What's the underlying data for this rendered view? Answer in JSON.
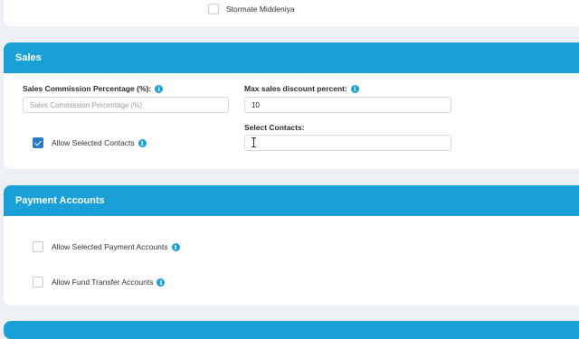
{
  "top_section": {
    "checkbox_label": "Stormate Middeniya",
    "checked": false
  },
  "sales": {
    "title": "Sales",
    "commission_label": "Sales Commission Percentage (%):",
    "commission_placeholder": "Sales Commission Percentage (%)",
    "max_discount_label": "Max sales discount percent:",
    "max_discount_value": "10",
    "allow_contacts_label": "Allow Selected Contacts",
    "allow_contacts_checked": true,
    "select_contacts_label": "Select Contacts:",
    "select_contacts_value": ""
  },
  "payment_accounts": {
    "title": "Payment Accounts",
    "items": [
      {
        "label": "Allow Selected Payment Accounts",
        "checked": false
      },
      {
        "label": "Allow Fund Transfer Accounts",
        "checked": false
      }
    ]
  },
  "colors": {
    "header_bg": "#1aa0d9",
    "checkbox_checked": "#2a79c2",
    "page_bg": "#edf0f5"
  },
  "icons": {
    "info": "info-icon",
    "check": "check-icon"
  }
}
